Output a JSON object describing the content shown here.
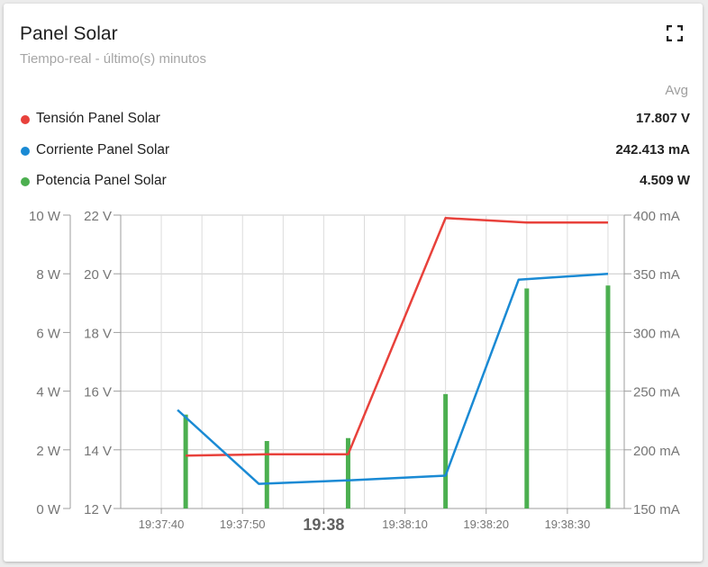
{
  "widget": {
    "title": "Panel Solar",
    "subtitle": "Tiempo-real - último(s) minutos",
    "avg_header": "Avg"
  },
  "legend": [
    {
      "label": "Tensión Panel Solar",
      "value": "17.807 V",
      "color": "#e8413b"
    },
    {
      "label": "Corriente Panel Solar",
      "value": "242.413 mA",
      "color": "#1a8ad4"
    },
    {
      "label": "Potencia Panel Solar",
      "value": "4.509 W",
      "color": "#4caf50"
    }
  ],
  "chart_data": {
    "type": "line",
    "x_ticks": [
      "19:37:40",
      "19:37:50",
      "19:38",
      "19:38:10",
      "19:38:20",
      "19:38:30"
    ],
    "x_range": [
      "19:37:35",
      "19:38:37"
    ],
    "y_axes": {
      "power": {
        "ticks": [
          "0 W",
          "2 W",
          "4 W",
          "6 W",
          "8 W",
          "10 W"
        ],
        "range": [
          0,
          10
        ],
        "unit": "W"
      },
      "voltage": {
        "ticks": [
          "12 V",
          "14 V",
          "16 V",
          "18 V",
          "20 V",
          "22 V"
        ],
        "range": [
          12,
          22
        ],
        "unit": "V"
      },
      "current": {
        "ticks": [
          "150 mA",
          "200 mA",
          "250 mA",
          "300 mA",
          "350 mA",
          "400 mA"
        ],
        "range": [
          150,
          400
        ],
        "unit": "mA"
      }
    },
    "grid": true,
    "series": [
      {
        "name": "Tensión Panel Solar",
        "type": "line",
        "axis": "voltage",
        "color": "#e8413b",
        "points": [
          [
            "19:37:43",
            13.8
          ],
          [
            "19:37:53",
            13.85
          ],
          [
            "19:38:03",
            13.85
          ],
          [
            "19:38:15",
            21.9
          ],
          [
            "19:38:25",
            21.75
          ],
          [
            "19:38:35",
            21.75
          ]
        ]
      },
      {
        "name": "Corriente Panel Solar",
        "type": "line",
        "axis": "current",
        "color": "#1a8ad4",
        "points": [
          [
            "19:37:42",
            234
          ],
          [
            "19:37:52",
            171
          ],
          [
            "19:38:03",
            174
          ],
          [
            "19:38:15",
            178
          ],
          [
            "19:38:24",
            345
          ],
          [
            "19:38:35",
            350
          ]
        ]
      },
      {
        "name": "Potencia Panel Solar",
        "type": "bar",
        "axis": "power",
        "color": "#4caf50",
        "points": [
          [
            "19:37:43",
            3.2
          ],
          [
            "19:37:53",
            2.3
          ],
          [
            "19:38:03",
            2.4
          ],
          [
            "19:38:15",
            3.9
          ],
          [
            "19:38:25",
            7.5
          ],
          [
            "19:38:35",
            7.6
          ]
        ]
      }
    ]
  }
}
